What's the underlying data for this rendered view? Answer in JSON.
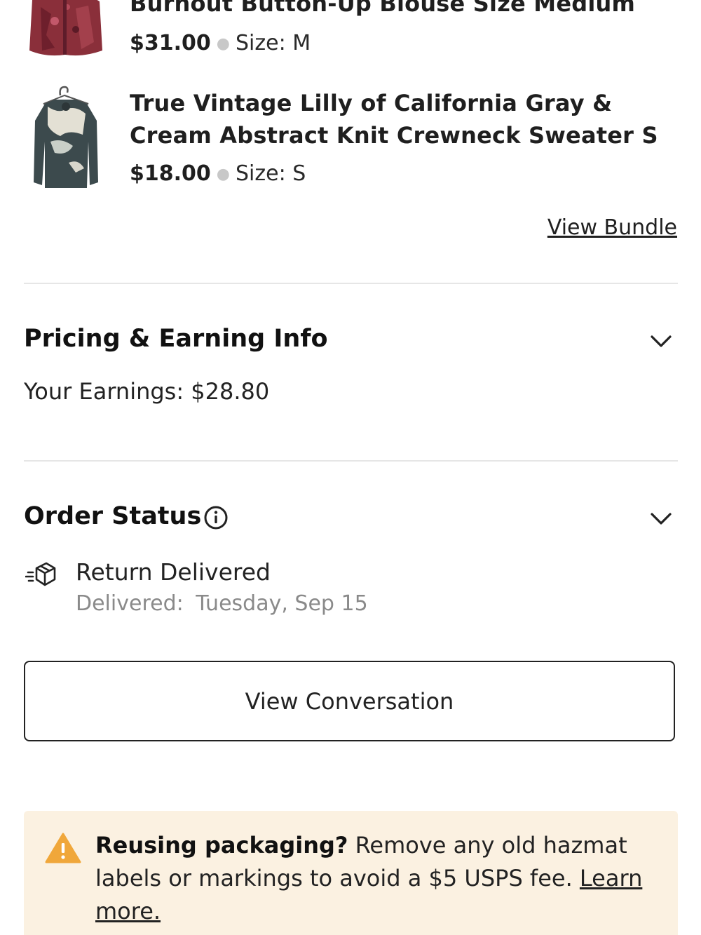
{
  "items": [
    {
      "title": "Burnout Button-Up Blouse Size Medium",
      "price": "$31.00",
      "size_label": "Size: M"
    },
    {
      "title": "True Vintage Lilly of California Gray & Cream Abstract Knit Crewneck Sweater S",
      "price": "$18.00",
      "size_label": "Size: S"
    }
  ],
  "bundle": {
    "view_bundle_label": "View Bundle"
  },
  "pricing": {
    "title": "Pricing & Earning Info",
    "earnings": "Your Earnings: $28.80"
  },
  "order_status": {
    "title": "Order Status",
    "status": "Return Delivered",
    "delivered_label": "Delivered:",
    "delivered_date": "Tuesday, Sep 15"
  },
  "actions": {
    "view_conversation_label": "View Conversation"
  },
  "notice": {
    "bold_text": "Reusing packaging?",
    "body_text": " Remove any old hazmat labels or markings to avoid a $5 USPS fee. ",
    "link_text": "Learn more."
  },
  "colors": {
    "divider": "#e6e6e6",
    "notice_bg": "#fbf1e1",
    "warning": "#f0a73a",
    "muted_text": "#8a8a8a"
  },
  "icons": {
    "pricing_chevron": "chevron-down-icon",
    "status_chevron": "chevron-down-icon",
    "status_info": "info-icon",
    "status_box": "package-icon",
    "notice_warning": "warning-icon"
  }
}
